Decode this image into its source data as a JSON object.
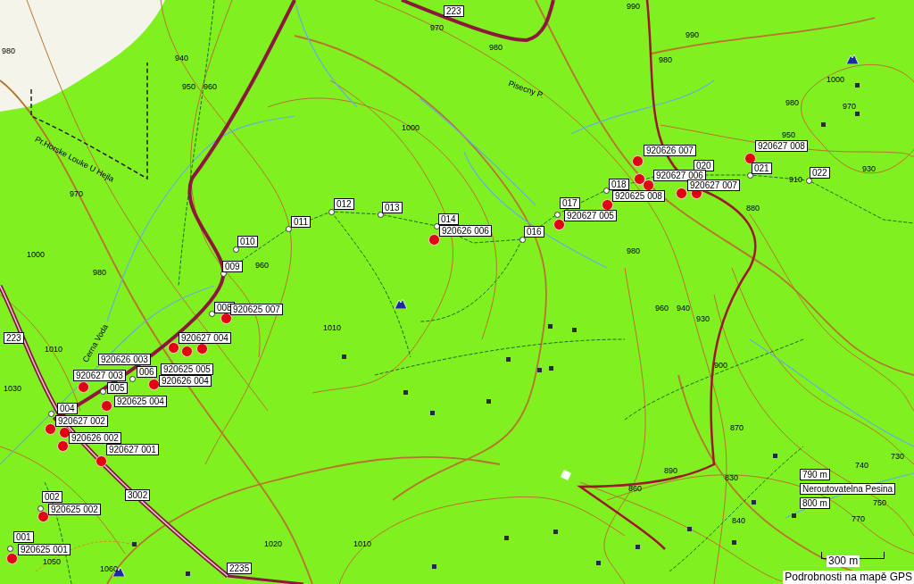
{
  "map": {
    "road_numbers": [
      "223",
      "223",
      "3002",
      "2235"
    ],
    "place_names": [
      "Pr.Horske Louke U Hejla",
      "Pisecny P.",
      "Cerna Voda"
    ],
    "elevation_labels": [
      "980",
      "940",
      "950",
      "960",
      "970",
      "1000",
      "980",
      "960",
      "970",
      "980",
      "1000",
      "1010",
      "1030",
      "1010",
      "1050",
      "1060",
      "1020",
      "1010",
      "990",
      "980",
      "990",
      "1000",
      "980",
      "970",
      "950",
      "930",
      "910",
      "880",
      "980",
      "960",
      "940",
      "930",
      "900",
      "870",
      "890",
      "860",
      "840",
      "830",
      "740",
      "730",
      "750",
      "770"
    ],
    "waypoints": [
      {
        "label": "001"
      },
      {
        "label": "002"
      },
      {
        "label": "004"
      },
      {
        "label": "005"
      },
      {
        "label": "006"
      },
      {
        "label": "008"
      },
      {
        "label": "009"
      },
      {
        "label": "010"
      },
      {
        "label": "011"
      },
      {
        "label": "012"
      },
      {
        "label": "013"
      },
      {
        "label": "014"
      },
      {
        "label": "016"
      },
      {
        "label": "017"
      },
      {
        "label": "018"
      },
      {
        "label": "020"
      },
      {
        "label": "021"
      },
      {
        "label": "022"
      }
    ],
    "point_labels": [
      "920627 008",
      "920626 007",
      "920627 006",
      "920627 007",
      "920625 008",
      "920627 005",
      "920626 006",
      "920625 007",
      "920627 004",
      "920626 003",
      "920625 005",
      "920627 003",
      "920626 004",
      "920625 004",
      "920627 002",
      "920626 002",
      "920627 001",
      "920625 002",
      "920625 001"
    ],
    "poi": {
      "elevations": [
        "790 m",
        "800 m"
      ],
      "name": "Neroutovatelna Pesina"
    },
    "scale": "300 m",
    "status": "Podrobnosti na mapě GPS"
  }
}
